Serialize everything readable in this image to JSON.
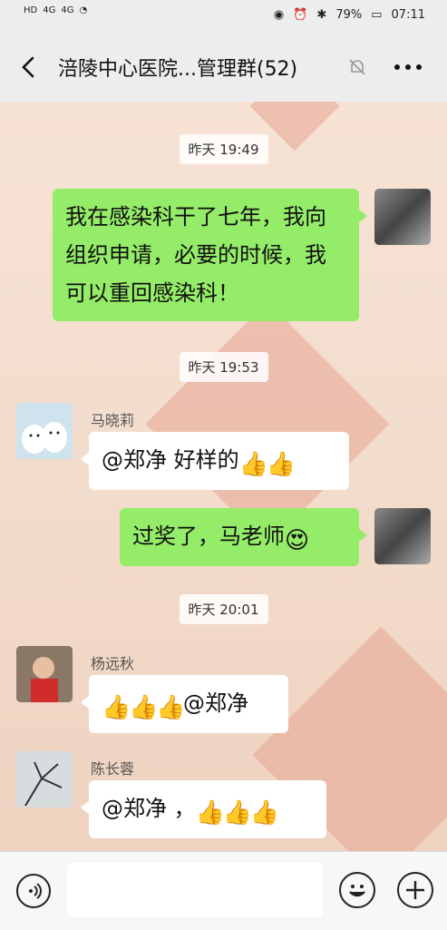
{
  "status": {
    "left_labels": [
      "HD",
      "4G",
      "4G"
    ],
    "battery": "79%",
    "time": "07:11"
  },
  "nav": {
    "title": "涪陵中心医院...管理群(52)"
  },
  "chat": {
    "time1": "昨天 19:49",
    "msg1": "我在感染科干了七年，我向组织申请，必要的时候，我可以重回感染科！",
    "time2": "昨天 19:53",
    "sender2": "马晓莉",
    "msg2_text": "@郑净  好样的",
    "msg3_text": "过奖了，马老师",
    "time3": "昨天 20:01",
    "sender4": "杨远秋",
    "msg4_text": "@郑净",
    "sender5": "陈长蓉",
    "msg5_text": "@郑净 ，"
  },
  "colors": {
    "green_bubble": "#95ec69",
    "bar_bg": "#ededed"
  },
  "icons": {
    "thumbs_up": "👍",
    "heart_eyes": "😍"
  }
}
